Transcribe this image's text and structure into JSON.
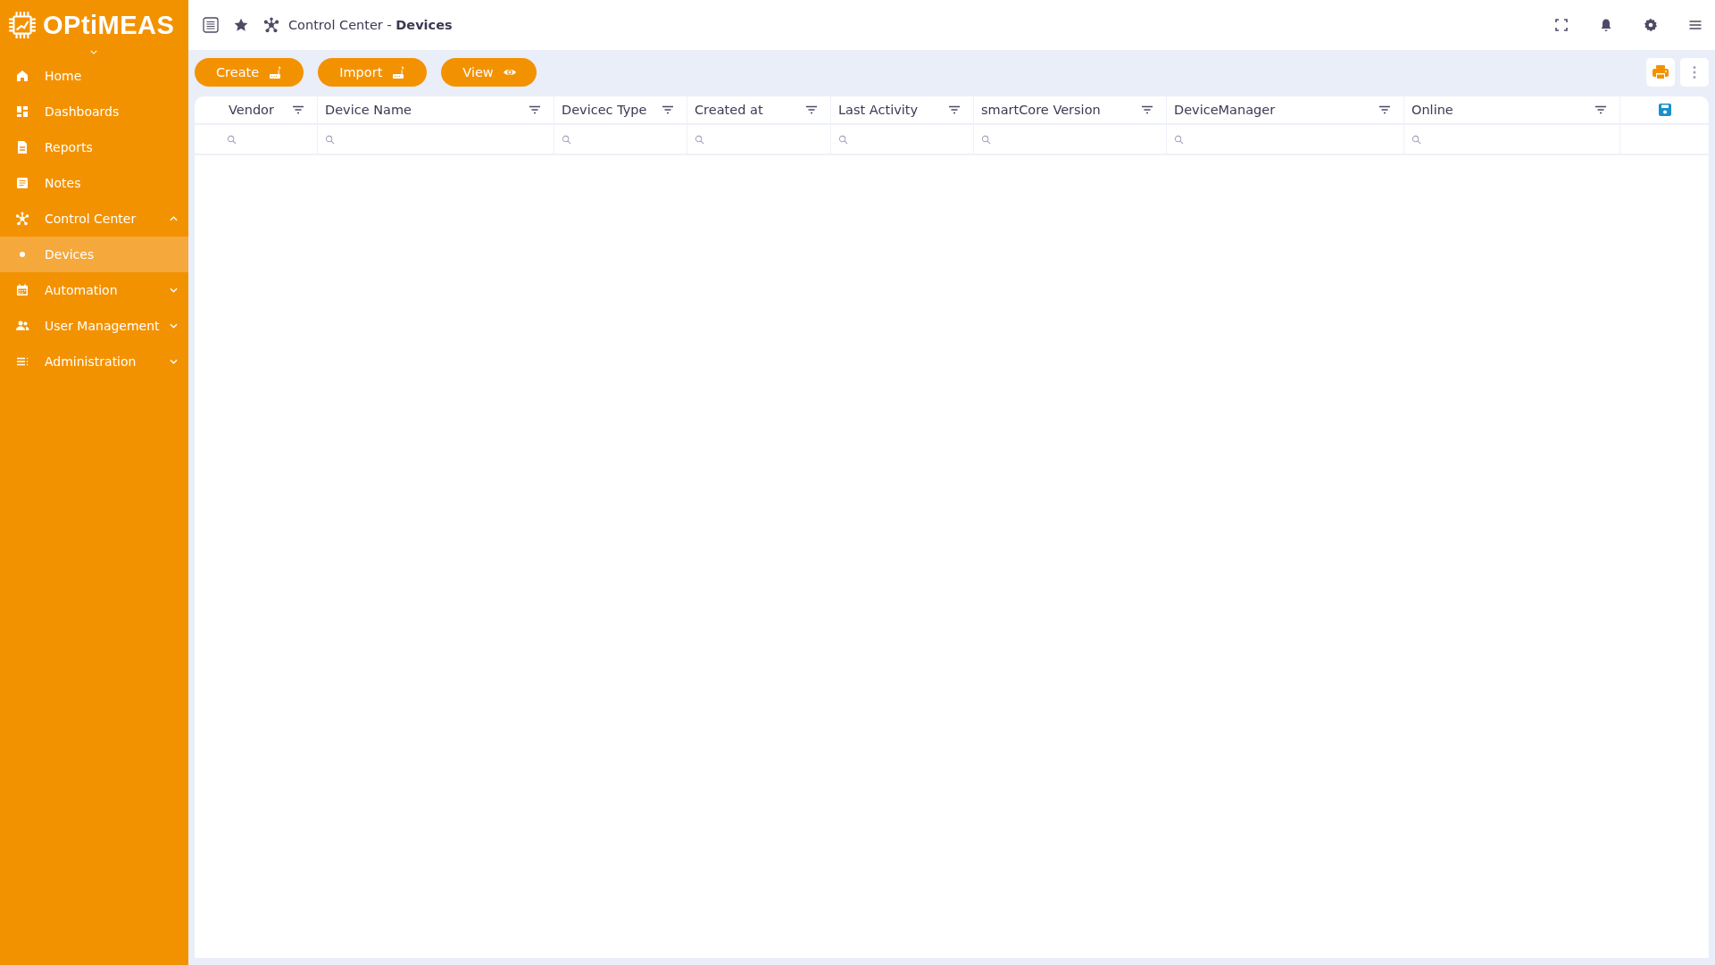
{
  "sidebar": {
    "logo": "OPtiMEAS",
    "items": [
      {
        "label": "Home",
        "kind": "home",
        "selected": false
      },
      {
        "label": "Dashboards",
        "kind": "dashboard",
        "selected": false
      },
      {
        "label": "Reports",
        "kind": "report",
        "selected": false
      },
      {
        "label": "Notes",
        "kind": "note",
        "selected": false
      },
      {
        "label": "Control Center",
        "kind": "hub",
        "selected": false,
        "expanded": true,
        "children": [
          {
            "label": "Devices",
            "selected": true
          }
        ]
      },
      {
        "label": "Automation",
        "kind": "calendar",
        "selected": false,
        "expanded": false
      },
      {
        "label": "User Management",
        "kind": "users",
        "selected": false,
        "expanded": false
      },
      {
        "label": "Administration",
        "kind": "list",
        "selected": false,
        "expanded": false
      }
    ]
  },
  "breadcrumb": {
    "section": "Control Center - ",
    "page": "Devices"
  },
  "toolbar": {
    "buttons": [
      {
        "label": "Create",
        "kind": "router"
      },
      {
        "label": "Import",
        "kind": "router"
      },
      {
        "label": "View",
        "kind": "eye"
      }
    ]
  },
  "table": {
    "columns": [
      {
        "label": "Vendor"
      },
      {
        "label": "Device Name"
      },
      {
        "label": "Devicec Type"
      },
      {
        "label": "Created at"
      },
      {
        "label": "Last Activity"
      },
      {
        "label": "smartCore Version"
      },
      {
        "label": "DeviceManager"
      },
      {
        "label": "Online"
      }
    ]
  }
}
